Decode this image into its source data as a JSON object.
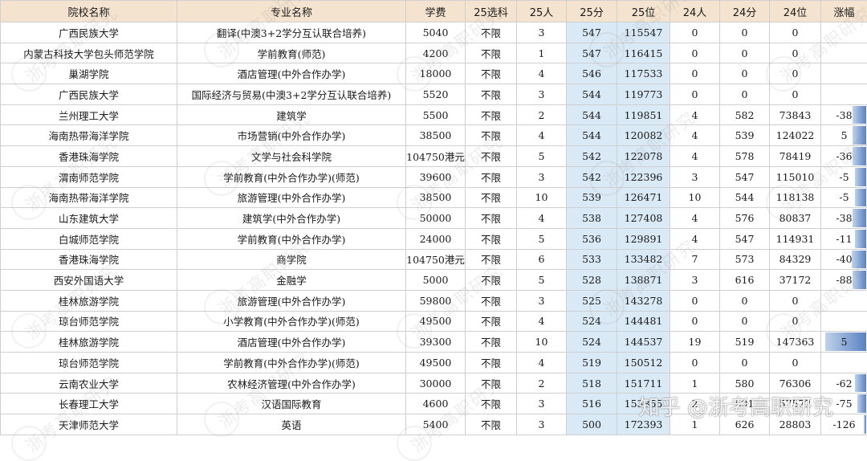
{
  "headers": [
    "院校名称",
    "专业名称",
    "学费",
    "25选科",
    "25人",
    "25分",
    "25位",
    "24人",
    "24分",
    "24位",
    "涨幅"
  ],
  "rows": [
    [
      "广西民族大学",
      "翻译(中澳3+2学分互认联合培养)",
      "5040",
      "不限",
      "3",
      "547",
      "115547",
      "0",
      "0",
      "0",
      ""
    ],
    [
      "内蒙古科技大学包头师范学院",
      "学前教育(师范)",
      "4200",
      "不限",
      "1",
      "547",
      "116415",
      "0",
      "0",
      "0",
      ""
    ],
    [
      "巢湖学院",
      "酒店管理(中外合作办学)",
      "18000",
      "不限",
      "4",
      "546",
      "117533",
      "0",
      "0",
      "0",
      ""
    ],
    [
      "广西民族大学",
      "国际经济与贸易(中澳3+2学分互认联合培养)",
      "5520",
      "不限",
      "3",
      "544",
      "119773",
      "0",
      "0",
      "0",
      ""
    ],
    [
      "兰州理工大学",
      "建筑学",
      "5500",
      "不限",
      "2",
      "544",
      "119851",
      "4",
      "582",
      "73843",
      "-38"
    ],
    [
      "海南热带海洋学院",
      "市场营销(中外合作办学)",
      "38500",
      "不限",
      "4",
      "544",
      "120082",
      "4",
      "539",
      "124022",
      "5"
    ],
    [
      "香港珠海学院",
      "文学与社会科学院",
      "104750港元",
      "不限",
      "5",
      "542",
      "122078",
      "4",
      "578",
      "78419",
      "-36"
    ],
    [
      "渭南师范学院",
      "学前教育(中外合作办学)(师范)",
      "39600",
      "不限",
      "3",
      "542",
      "122396",
      "3",
      "547",
      "115010",
      "-5"
    ],
    [
      "海南热带海洋学院",
      "旅游管理(中外合作办学)",
      "38500",
      "不限",
      "10",
      "539",
      "126471",
      "10",
      "544",
      "118138",
      "-5"
    ],
    [
      "山东建筑大学",
      "建筑学(中外合作办学)",
      "50000",
      "不限",
      "4",
      "538",
      "127408",
      "4",
      "576",
      "80837",
      "-38"
    ],
    [
      "白城师范学院",
      "学前教育(中外合作办学)",
      "24000",
      "不限",
      "5",
      "536",
      "129891",
      "4",
      "547",
      "114931",
      "-11"
    ],
    [
      "香港珠海学院",
      "商学院",
      "104750港元",
      "不限",
      "6",
      "533",
      "133482",
      "7",
      "573",
      "84329",
      "-40"
    ],
    [
      "西安外国语大学",
      "金融学",
      "5000",
      "不限",
      "5",
      "528",
      "138871",
      "3",
      "616",
      "37172",
      "-88"
    ],
    [
      "桂林旅游学院",
      "旅游管理(中外合作办学)",
      "59800",
      "不限",
      "3",
      "525",
      "143278",
      "0",
      "0",
      "0",
      ""
    ],
    [
      "琼台师范学院",
      "小学教育(中外合作办学)(师范)",
      "49500",
      "不限",
      "4",
      "524",
      "144481",
      "0",
      "0",
      "0",
      ""
    ],
    [
      "桂林旅游学院",
      "酒店管理(中外合作办学)",
      "39300",
      "不限",
      "10",
      "524",
      "144537",
      "19",
      "519",
      "147363",
      "5"
    ],
    [
      "琼台师范学院",
      "学前教育(中外合作办学)(师范)",
      "49500",
      "不限",
      "4",
      "519",
      "150512",
      "0",
      "0",
      "0",
      ""
    ],
    [
      "云南农业大学",
      "农林经济管理(中外合作办学)",
      "30000",
      "不限",
      "2",
      "518",
      "151711",
      "1",
      "580",
      "76306",
      "-62"
    ],
    [
      "长春理工大学",
      "汉语国际教育",
      "4600",
      "不限",
      "3",
      "516",
      "153855",
      "2",
      "591",
      "57572",
      "-75"
    ],
    [
      "天津师范大学",
      "英语",
      "5400",
      "不限",
      "3",
      "500",
      "172393",
      "1",
      "626",
      "28803",
      "-126"
    ]
  ],
  "growth_bar_fraction": [
    0,
    0,
    0,
    0,
    0.3,
    0.3,
    0.29,
    0.25,
    0.25,
    0.3,
    0.24,
    0.32,
    0.3,
    0,
    0,
    0.9,
    0,
    0.25,
    0.2,
    0.05
  ],
  "watermark_text": "浙考高职研究",
  "logo_text": "知乎 @浙考高职研究",
  "colors": {
    "header_bg": "#f4e3cf",
    "highlight_bg": "#dae9f6",
    "bar_dark": "#5a82c2",
    "bar_light": "#bfd2ea",
    "border": "#cfcfcf"
  }
}
